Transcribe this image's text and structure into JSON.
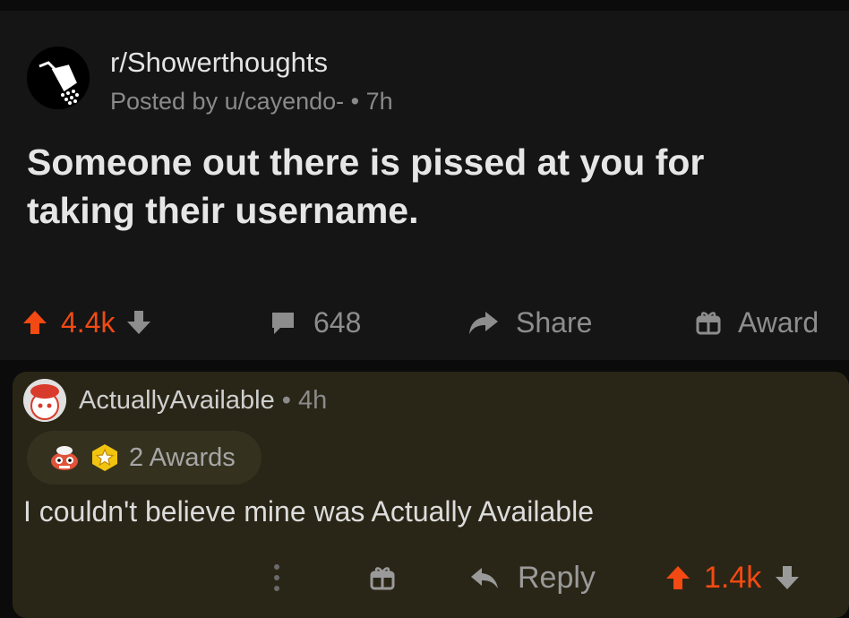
{
  "post": {
    "subreddit": "r/Showerthoughts",
    "posted_by": "Posted by u/cayendo- • 7h",
    "title": "Someone out there is pissed at you for taking their username.",
    "score": "4.4k",
    "comment_count": "648",
    "share_label": "Share",
    "award_label": "Award"
  },
  "comment": {
    "author": "ActuallyAvailable",
    "time": " • 4h",
    "awards_label": "2 Awards",
    "body": "I couldn't believe mine was Actually Available",
    "reply_label": "Reply",
    "score": "1.4k"
  },
  "colors": {
    "upvote": "#f24a12",
    "post_bg": "#151515",
    "comment_bg": "#2a2617",
    "muted": "#8d8d8d"
  }
}
